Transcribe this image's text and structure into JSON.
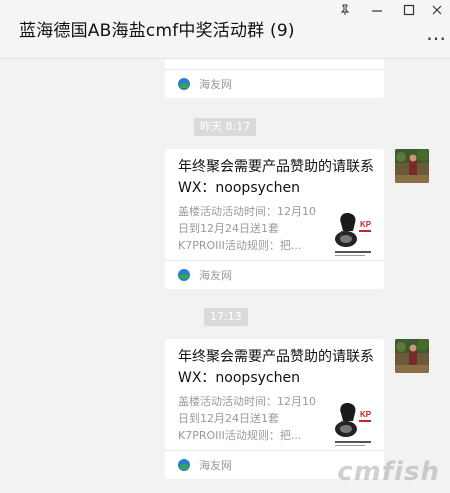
{
  "window": {
    "title": "蓝海德国AB海盐cmf中奖活动群 (9)",
    "pin_icon": "pin-icon",
    "minimize_icon": "minimize-icon",
    "maximize_icon": "maximize-icon",
    "close_icon": "close-icon",
    "more_icon": "more-dots-icon"
  },
  "messages": [
    {
      "type": "link-card-partial",
      "source": "海友网"
    },
    {
      "type": "timestamp",
      "text": "昨天 8:17"
    },
    {
      "type": "link-card",
      "title": "年终聚会需要产品赞助的请联系WX：noopsychen",
      "description": "盖楼活动活动时间：12月10日到12月24日送1套K7PROIII活动规则：把...",
      "source": "海友网",
      "thumbnail_icon": "product-image-icon"
    },
    {
      "type": "timestamp",
      "text": "17:13"
    },
    {
      "type": "link-card",
      "title": "年终聚会需要产品赞助的请联系WX：noopsychen",
      "description": "盖楼活动活动时间：12月10日到12月24日送1套K7PROIII活动规则：把...",
      "source": "海友网",
      "thumbnail_icon": "product-image-icon"
    }
  ],
  "watermark": "cmfish",
  "colors": {
    "background": "#f2f2f2",
    "card": "#ffffff",
    "timestamp_pill": "#dadada",
    "muted_text": "#9a9a9a"
  }
}
